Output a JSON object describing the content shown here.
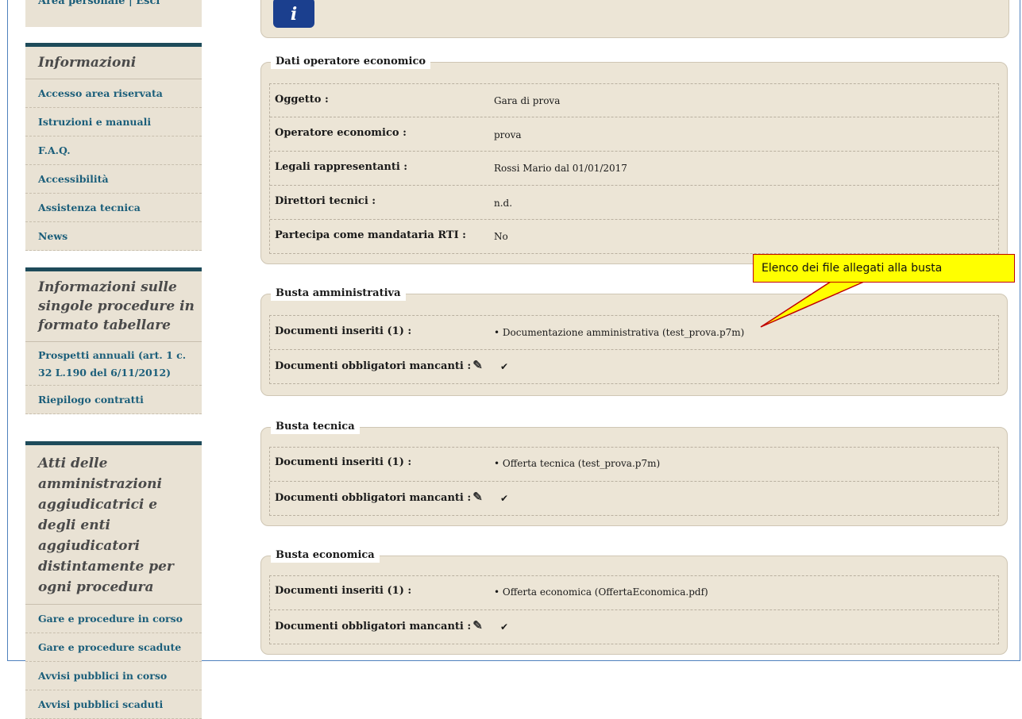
{
  "sidebar": {
    "user_links": "Area personale | Esci",
    "sections": [
      {
        "title": "Informazioni",
        "items": [
          "Accesso area riservata",
          "Istruzioni e manuali",
          "F.A.Q.",
          "Accessibilità",
          "Assistenza tecnica",
          "News"
        ]
      },
      {
        "title": "Informazioni sulle singole procedure in formato tabellare",
        "items": [
          "Prospetti annuali (art. 1 c. 32 L.190 del 6/11/2012)",
          "Riepilogo contratti"
        ]
      },
      {
        "title": "Atti delle amministrazioni aggiudicatrici e degli enti aggiudicatori distintamente per ogni procedura",
        "items": [
          "Gare e procedure in corso",
          "Gare e procedure scadute",
          "Avvisi pubblici in corso",
          "Avvisi pubblici scaduti"
        ]
      }
    ]
  },
  "info_icon": "info-icon",
  "operatore": {
    "legend": "Dati operatore economico",
    "rows": [
      {
        "label": "Oggetto :",
        "value": "Gara di prova"
      },
      {
        "label": "Operatore economico :",
        "value": "prova"
      },
      {
        "label": "Legali rappresentanti :",
        "value": "Rossi Mario dal 01/01/2017"
      },
      {
        "label": "Direttori tecnici :",
        "value": "n.d."
      },
      {
        "label": "Partecipa come mandataria RTI :",
        "value": "No"
      }
    ]
  },
  "buste": [
    {
      "legend": "Busta amministrativa",
      "docs_label": "Documenti inseriti (1) :",
      "docs_value": "• Documentazione amministrativa  (test_prova.p7m)",
      "missing_label": "Documenti obbligatori mancanti :"
    },
    {
      "legend": "Busta tecnica",
      "docs_label": "Documenti inseriti (1) :",
      "docs_value": "• Offerta tecnica  (test_prova.p7m)",
      "missing_label": "Documenti obbligatori mancanti :"
    },
    {
      "legend": "Busta economica",
      "docs_label": "Documenti inseriti (1) :",
      "docs_value": "• Offerta economica  (OffertaEconomica.pdf)",
      "missing_label": "Documenti obbligatori mancanti :"
    }
  ],
  "callout": {
    "text": "Elenco dei file allegati alla busta",
    "color": "#ffff00",
    "border_color": "#c00000"
  },
  "colors": {
    "panel_bg": "#ece5d6",
    "sidebar_bg": "#e9e2d4",
    "link": "#1b5e7a",
    "section_border": "#1e4b5a",
    "info_bg": "#1b3f8e"
  }
}
